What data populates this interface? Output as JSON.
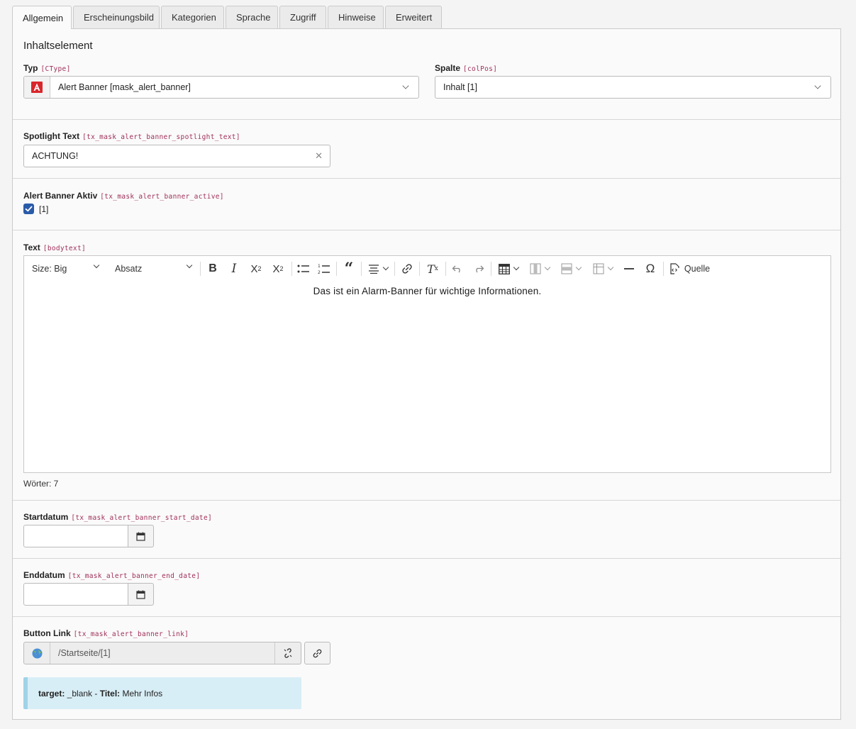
{
  "tabs": [
    "Allgemein",
    "Erscheinungsbild",
    "Kategorien",
    "Sprache",
    "Zugriff",
    "Hinweise",
    "Erweitert"
  ],
  "section_title": "Inhaltselement",
  "typ": {
    "label": "Typ",
    "code": "[CType]",
    "value": "Alert Banner [mask_alert_banner]",
    "icon": "alert-banner-icon"
  },
  "spalte": {
    "label": "Spalte",
    "code": "[colPos]",
    "value": "Inhalt [1]"
  },
  "spotlight": {
    "label": "Spotlight Text",
    "code": "[tx_mask_alert_banner_spotlight_text]",
    "value": "ACHTUNG!"
  },
  "active": {
    "label": "Alert Banner Aktiv",
    "code": "[tx_mask_alert_banner_active]",
    "checkbox_label": "[1]",
    "checked": true
  },
  "text": {
    "label": "Text",
    "code": "[bodytext]",
    "size_select": "Size: Big",
    "format_select": "Absatz",
    "source_label": "Quelle",
    "content": "Das ist ein Alarm-Banner für wichtige Informationen.",
    "word_count": "Wörter: 7"
  },
  "startdatum": {
    "label": "Startdatum",
    "code": "[tx_mask_alert_banner_start_date]",
    "value": ""
  },
  "enddatum": {
    "label": "Enddatum",
    "code": "[tx_mask_alert_banner_end_date]",
    "value": ""
  },
  "link": {
    "label": "Button Link",
    "code": "[tx_mask_alert_banner_link]",
    "value": "/Startseite/[1]",
    "info_target_key": "target:",
    "info_target_val": " _blank - ",
    "info_title_key": "Titel:",
    "info_title_val": " Mehr Infos"
  },
  "colors": {
    "accent": "#2a5ba9",
    "code": "#a0305a",
    "callout": "#d8eef6",
    "icon_red": "#d9262c"
  }
}
